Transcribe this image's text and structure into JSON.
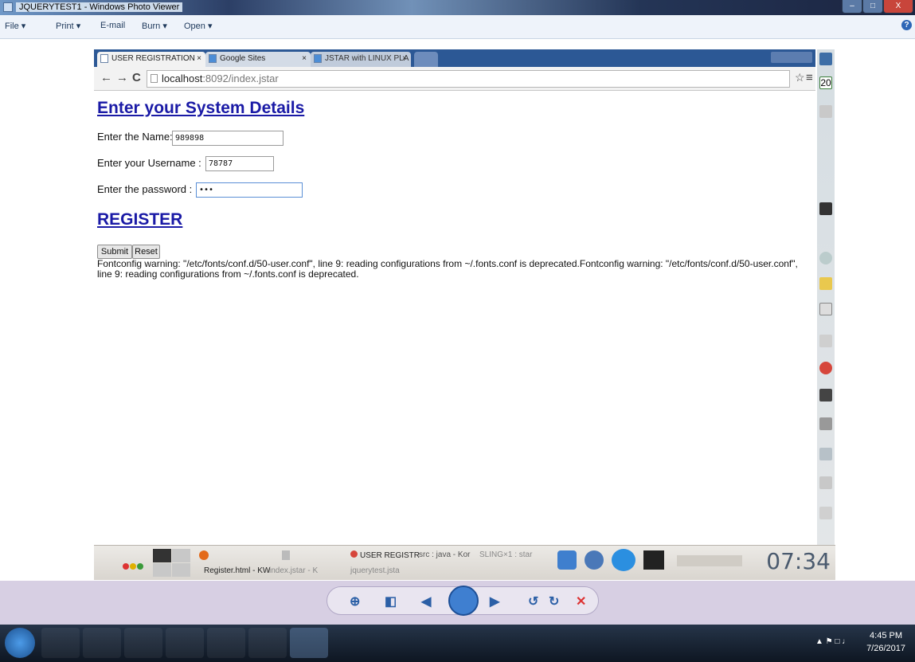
{
  "window": {
    "title": "JQUERYTEST1 - Windows Photo Viewer",
    "min": "–",
    "max": "□",
    "close": "X"
  },
  "menu": {
    "file": "File",
    "print": "Print",
    "email": "E-mail",
    "burn": "Burn",
    "open": "Open",
    "arrow": "▾",
    "help": "?"
  },
  "browser": {
    "tabs": [
      {
        "label": "USER REGISTRATION",
        "close": "×"
      },
      {
        "label": "Google Sites",
        "close": "×"
      },
      {
        "label": "JSTAR with LINUX PLA",
        "close": "×"
      }
    ],
    "nav": {
      "back": "←",
      "forward": "→",
      "reload": "C"
    },
    "url_host": "localhost",
    "url_rest": ":8092/index.jstar",
    "star": "☆",
    "menu": "≡"
  },
  "page": {
    "heading1": "Enter your System Details",
    "name_label": "Enter the Name:",
    "name_value": "989898",
    "username_label": "Enter your Username :",
    "username_value": "78787",
    "password_label": "Enter the password :",
    "password_value": "•••",
    "heading2": "REGISTER",
    "submit": "Submit",
    "reset": "Reset",
    "warning": "Fontconfig warning: \"/etc/fonts/conf.d/50-user.conf\", line 9: reading configurations from ~/.fonts.conf is deprecated.Fontconfig warning: \"/etc/fonts/conf.d/50-user.conf\", line 9: reading configurations from ~/.fonts.conf is deprecated."
  },
  "kde_dock": {
    "calendar_day": "20"
  },
  "kde_panel": {
    "tasks": [
      "Register.html - KW",
      "index.jstar - K",
      "jquerytest.jsta"
    ],
    "windows": [
      "USER REGISTR",
      "src : java - Kor",
      "SLING×1 : star"
    ],
    "clock": "07:34"
  },
  "taskbar": {
    "time": "4:45 PM",
    "date": "7/26/2017"
  }
}
